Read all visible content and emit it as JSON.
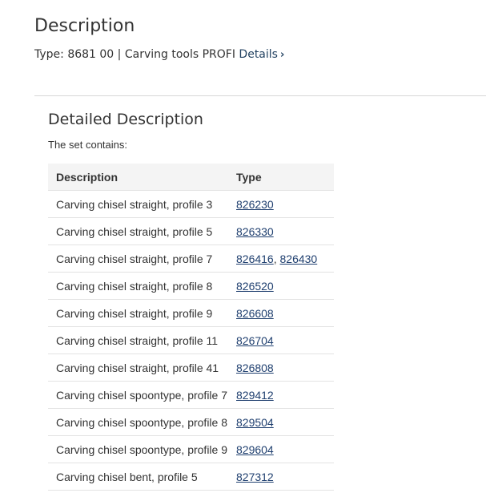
{
  "header": {
    "title": "Description",
    "type_prefix": "Type: 8681 00 | Carving tools PROFI",
    "details_label": "Details"
  },
  "detailed": {
    "title": "Detailed Description",
    "intro": "The set contains:",
    "columns": [
      "Description",
      "Type"
    ],
    "rows": [
      {
        "description": "Carving chisel straight, profile 3",
        "types": [
          "826230"
        ]
      },
      {
        "description": "Carving chisel straight, profile 5",
        "types": [
          "826330"
        ]
      },
      {
        "description": "Carving chisel straight, profile 7",
        "types": [
          "826416",
          "826430"
        ]
      },
      {
        "description": "Carving chisel straight, profile 8",
        "types": [
          "826520"
        ]
      },
      {
        "description": "Carving chisel straight, profile 9",
        "types": [
          "826608"
        ]
      },
      {
        "description": "Carving chisel straight, profile 11",
        "types": [
          "826704"
        ]
      },
      {
        "description": "Carving chisel straight, profile 41",
        "types": [
          "826808"
        ]
      },
      {
        "description": "Carving chisel spoontype, profile 7",
        "types": [
          "829412"
        ]
      },
      {
        "description": "Carving chisel spoontype, profile 8",
        "types": [
          "829504"
        ]
      },
      {
        "description": "Carving chisel spoontype, profile 9",
        "types": [
          "829604"
        ]
      },
      {
        "description": "Carving chisel bent, profile 5",
        "types": [
          "827312"
        ]
      }
    ]
  }
}
